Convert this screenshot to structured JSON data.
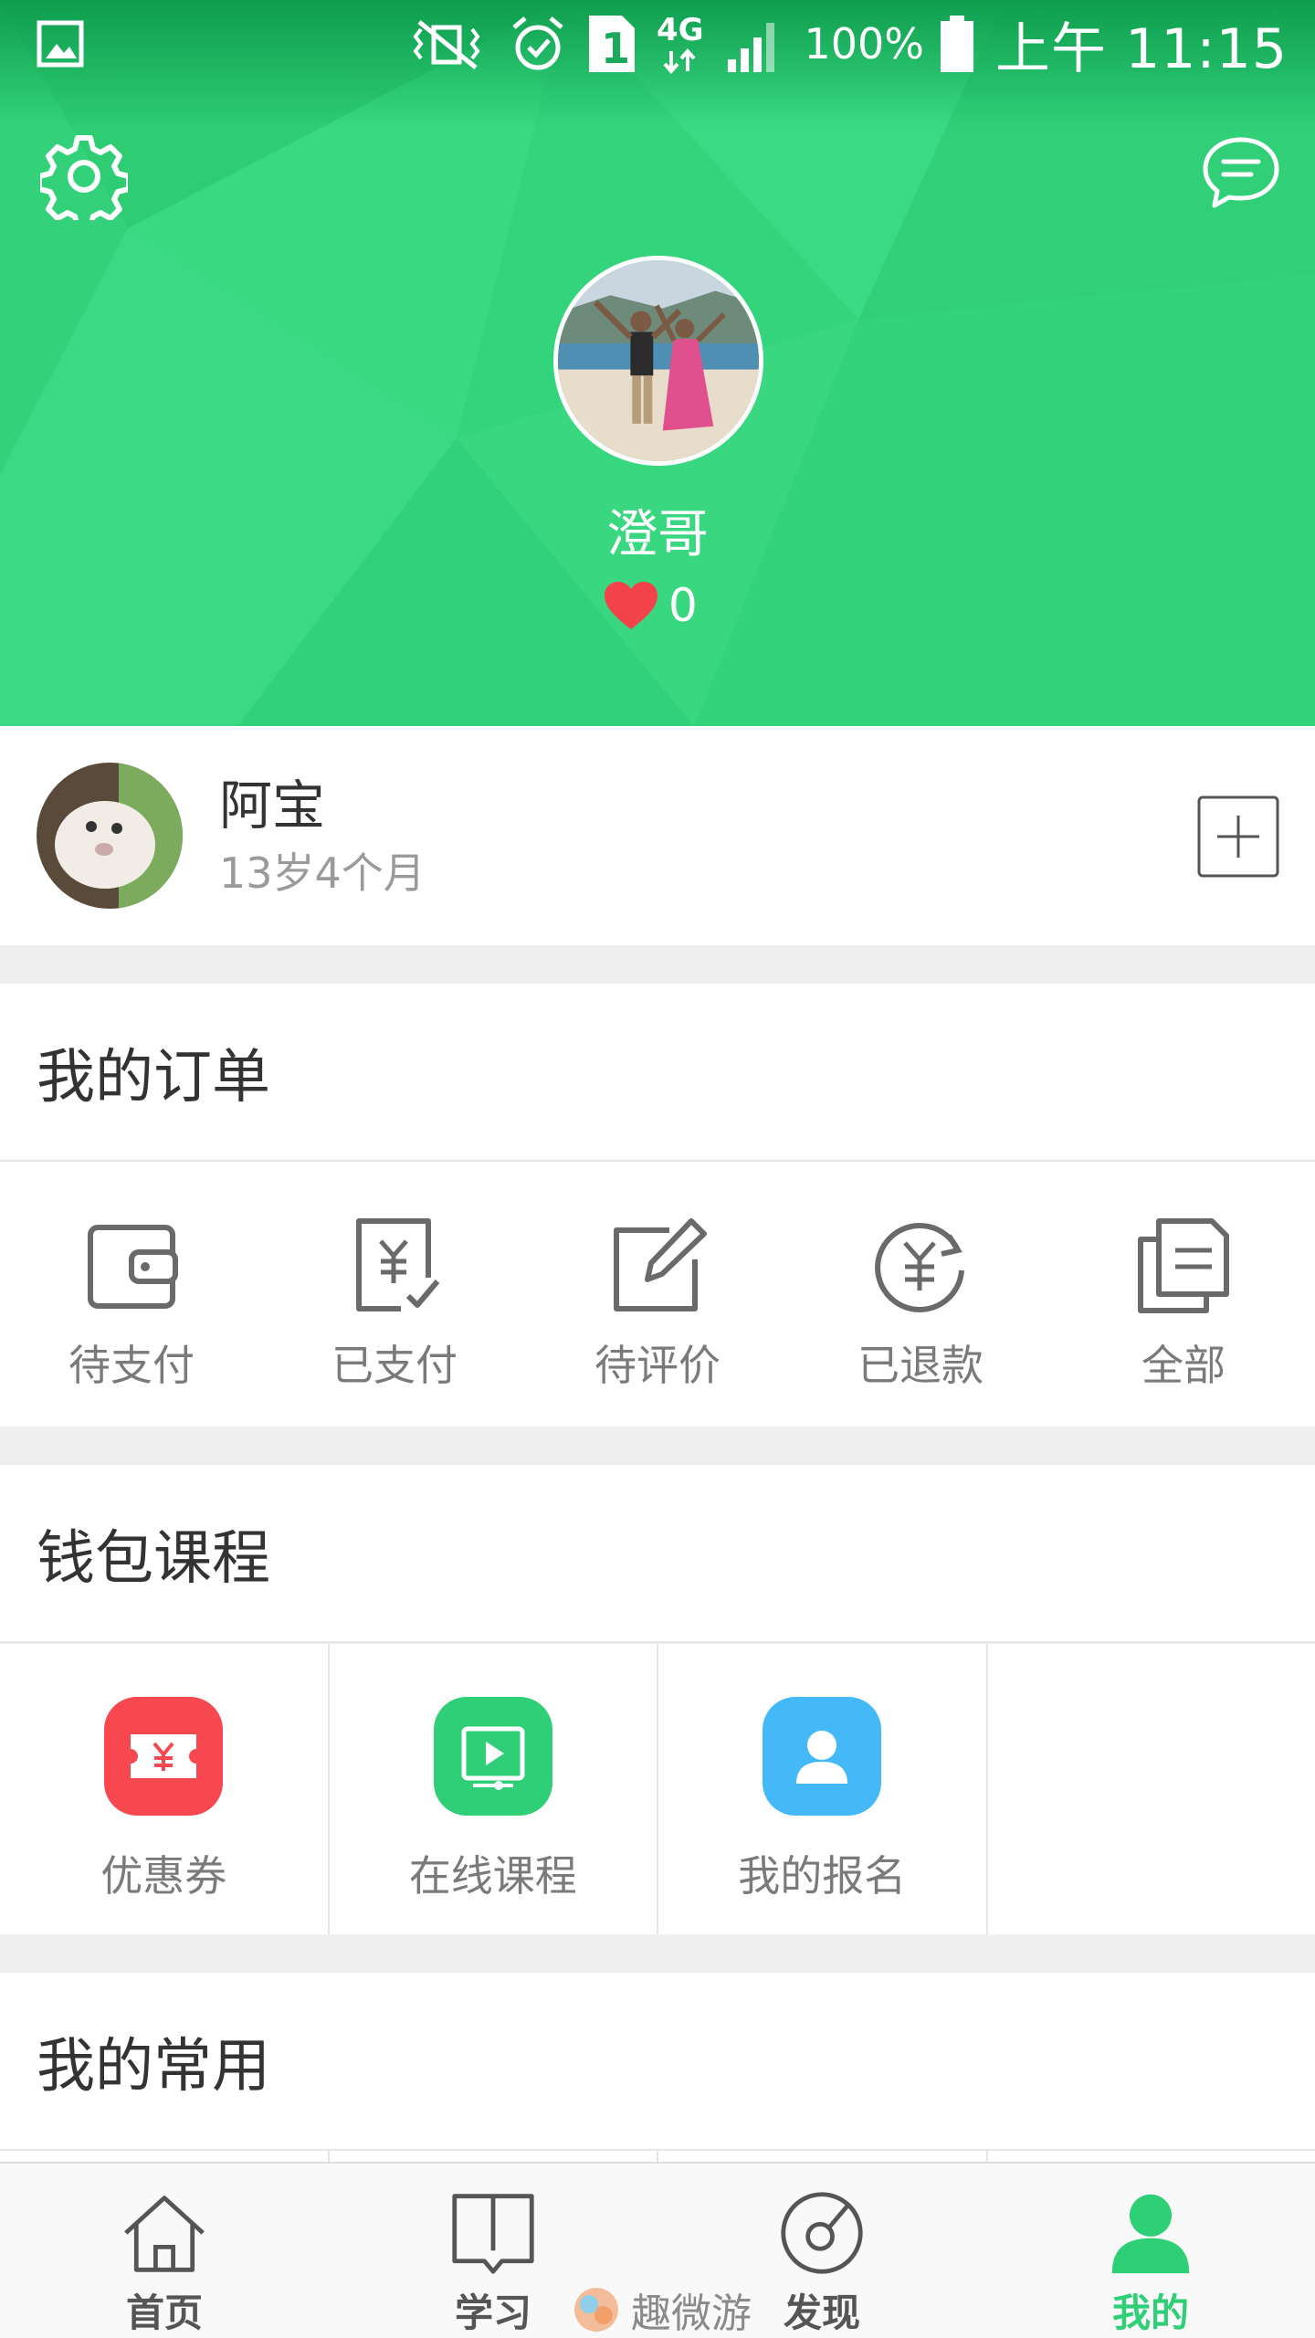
{
  "status_bar": {
    "battery": "100%",
    "time": "上午 11:15",
    "network": "4G",
    "sim": "1"
  },
  "profile": {
    "name": "澄哥",
    "likes": "0"
  },
  "child": {
    "name": "阿宝",
    "age": "13岁4个月"
  },
  "orders": {
    "title": "我的订单",
    "items": [
      {
        "label": "待支付",
        "icon": "wallet-icon"
      },
      {
        "label": "已支付",
        "icon": "paid-receipt-icon"
      },
      {
        "label": "待评价",
        "icon": "edit-review-icon"
      },
      {
        "label": "已退款",
        "icon": "refund-icon"
      },
      {
        "label": "全部",
        "icon": "all-orders-icon"
      }
    ]
  },
  "wallet": {
    "title": "钱包课程",
    "items": [
      {
        "label": "优惠券",
        "icon": "coupon-icon",
        "color": "#f7474f"
      },
      {
        "label": "在线课程",
        "icon": "video-course-icon",
        "color": "#2fcf77"
      },
      {
        "label": "我的报名",
        "icon": "person-icon",
        "color": "#45b9f8"
      }
    ]
  },
  "common": {
    "title": "我的常用"
  },
  "tabs": [
    {
      "label": "首页",
      "icon": "home-icon"
    },
    {
      "label": "学习",
      "icon": "book-icon"
    },
    {
      "label": "发现",
      "icon": "compass-icon"
    },
    {
      "label": "我的",
      "icon": "user-icon",
      "active": true
    }
  ],
  "watermark": "趣微游",
  "colors": {
    "header_green": "#35d67e",
    "accent_green": "#2fcf77",
    "heart_red": "#f4424b"
  }
}
